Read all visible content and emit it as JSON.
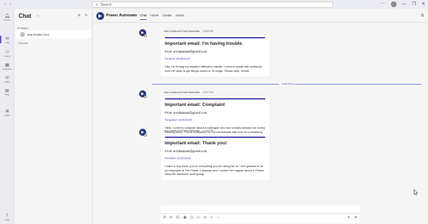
{
  "search": {
    "placeholder": "Search"
  },
  "titlebar": {
    "more": "···",
    "minimize": "—",
    "restore": "❐",
    "close": "✕"
  },
  "rail": {
    "items": [
      {
        "label": "Activity",
        "icon": "bell-icon"
      },
      {
        "label": "Chat",
        "icon": "chat-icon"
      },
      {
        "label": "Teams",
        "icon": "teams-icon"
      },
      {
        "label": "Calendar",
        "icon": "calendar-icon"
      },
      {
        "label": "Calls",
        "icon": "phone-icon"
      },
      {
        "label": "Files",
        "icon": "file-icon"
      },
      {
        "label": "Apps",
        "icon": "apps-icon"
      },
      {
        "label": "Help",
        "icon": "help-icon"
      }
    ]
  },
  "chatlist": {
    "title": "Chat",
    "section_pinned": "Pinned",
    "section_recent": "Recent",
    "me_name": "Ana Urrutia (You)"
  },
  "header": {
    "app_name": "Power Automate",
    "tabs": [
      "Chat",
      "Home",
      "Create",
      "About"
    ]
  },
  "messages": [
    {
      "sender": "Ana Urrutia via Power Automate",
      "time": "10:00 PM",
      "card_title": "Important email: I'm having trouble.",
      "from": "From urrutiaanas@gmail.com",
      "sentiment": "Neutral sentiment",
      "body": "Hey,  I'm finding my situation difficult to handle. I need to speak with someone from HR asap to get things sorted or I'll resign. Please help.  Henrik."
    },
    {
      "sender": "Ana Urrutia via Power Automate",
      "time": "10:27 PM",
      "card_title": "Important email: Complaint",
      "from": "From urrutiaanas@gmail.com",
      "sentiment": "Negative sentiment",
      "body": "Hello. I want to complain about a colleague who has verbally abused me during working hours. This is a situation I'm not comfortable with and I'm considering resigning. Please sort this out as I'm super sad about this."
    },
    {
      "sender": "Ana Urrutia via Power Automate",
      "time": "10:33 PM",
      "card_title": "Important email: Thank you!",
      "from": "From urrutiaanas@gmail.com",
      "sentiment": "Positive sentiment",
      "body": "I want to say thank you for everything you are doing for us. I feel grateful to be an employee of The Power Company and I couldn't be happier about it. Please keep the awesome work going!"
    }
  ],
  "last_read": "Last read",
  "compose": {
    "placeholder": ""
  },
  "colors": {
    "accent": "#5b5fc7",
    "card_accent": "#4f52b2",
    "bot": "#2d3b7b"
  }
}
